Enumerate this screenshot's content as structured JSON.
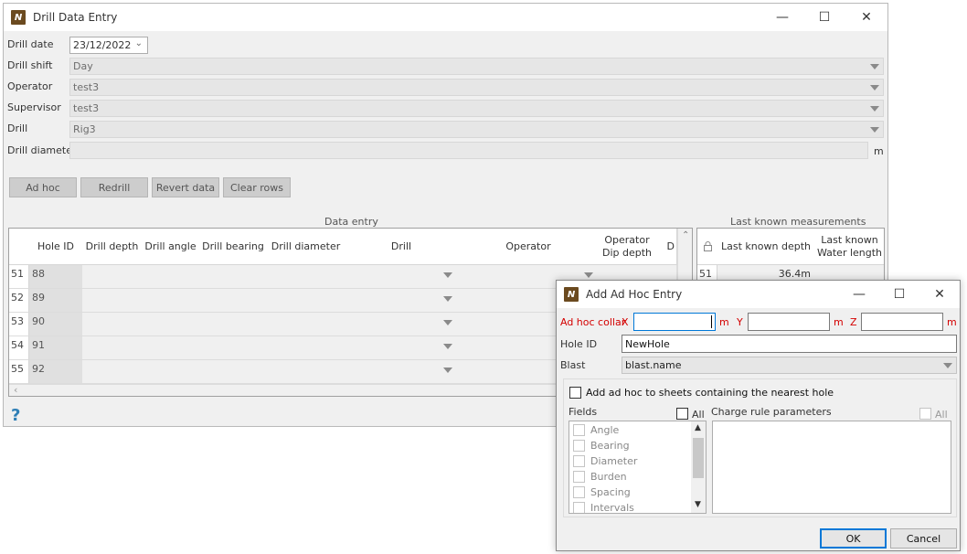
{
  "main_window": {
    "title": "Drill Data Entry",
    "app_icon": "app-logo-icon",
    "fields": {
      "drill_date_label": "Drill date",
      "drill_date_value": "23/12/2022",
      "drill_shift_label": "Drill shift",
      "drill_shift_value": "Day",
      "operator_label": "Operator",
      "operator_value": "test3",
      "supervisor_label": "Supervisor",
      "supervisor_value": "test3",
      "drill_label": "Drill",
      "drill_value": "Rig3",
      "drill_diameter_label": "Drill diameter",
      "drill_diameter_unit": "m"
    },
    "buttons": {
      "ad_hoc": "Ad hoc",
      "redrill": "Redrill",
      "revert_data": "Revert data",
      "clear_rows": "Clear rows"
    },
    "data_entry": {
      "caption": "Data entry",
      "columns": [
        "Hole ID",
        "Drill depth",
        "Drill angle",
        "Drill bearing",
        "Drill diameter",
        "Drill",
        "Operator",
        "Operator\nDip depth",
        "D"
      ],
      "rows": [
        {
          "row": "51",
          "hole_id": "88"
        },
        {
          "row": "52",
          "hole_id": "89"
        },
        {
          "row": "53",
          "hole_id": "90"
        },
        {
          "row": "54",
          "hole_id": "91"
        },
        {
          "row": "55",
          "hole_id": "92"
        }
      ]
    },
    "last_known": {
      "caption": "Last known measurements",
      "columns": [
        "Last known depth",
        "Last known\nWater length"
      ],
      "rows": [
        {
          "row": "51",
          "depth": "36.4m"
        }
      ]
    },
    "help_glyph": "?"
  },
  "dialog": {
    "title": "Add Ad Hoc Entry",
    "collar_label": "Ad hoc collar",
    "x_label": "X",
    "y_label": "Y",
    "z_label": "Z",
    "unit": "m",
    "hole_id_label": "Hole ID",
    "hole_id_value": "NewHole",
    "blast_label": "Blast",
    "blast_value": "blast.name",
    "add_to_sheets_label": "Add ad hoc to sheets containing the nearest hole",
    "fields_label": "Fields",
    "all_label": "All",
    "charge_label": "Charge rule parameters",
    "field_items": [
      "Angle",
      "Bearing",
      "Diameter",
      "Burden",
      "Spacing",
      "Intervals"
    ],
    "ok_label": "OK",
    "cancel_label": "Cancel"
  }
}
